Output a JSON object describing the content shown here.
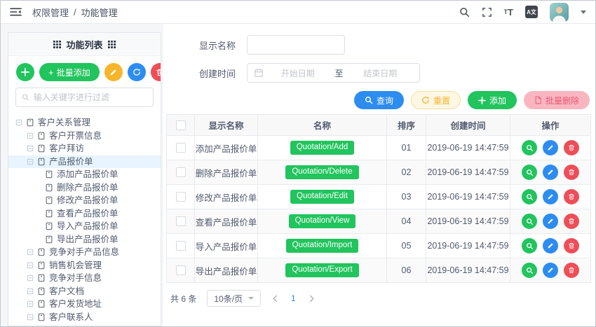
{
  "header": {
    "breadcrumb": {
      "section": "权限管理",
      "separator": "/",
      "current": "功能管理"
    }
  },
  "sidebar": {
    "title": "功能列表",
    "batch_add_label": "批量添加",
    "filter_placeholder": "输入关键字进行过滤",
    "tree": [
      {
        "label": "客户关系管理",
        "level": 1,
        "type": "branch"
      },
      {
        "label": "客户开票信息",
        "level": 2,
        "type": "branch"
      },
      {
        "label": "客户拜访",
        "level": 2,
        "type": "branch"
      },
      {
        "label": "产品报价单",
        "level": 2,
        "type": "branch",
        "selected": true
      },
      {
        "label": "添加产品报价单",
        "level": 3,
        "type": "leaf"
      },
      {
        "label": "删除产品报价单",
        "level": 3,
        "type": "leaf"
      },
      {
        "label": "修改产品报价单",
        "level": 3,
        "type": "leaf"
      },
      {
        "label": "查看产品报价单",
        "level": 3,
        "type": "leaf"
      },
      {
        "label": "导入产品报价单",
        "level": 3,
        "type": "leaf"
      },
      {
        "label": "导出产品报价单",
        "level": 3,
        "type": "leaf"
      },
      {
        "label": "竞争对手产品信息",
        "level": 2,
        "type": "branch"
      },
      {
        "label": "销售机会管理",
        "level": 2,
        "type": "branch"
      },
      {
        "label": "竞争对手信息",
        "level": 2,
        "type": "branch"
      },
      {
        "label": "客户文档",
        "level": 2,
        "type": "branch"
      },
      {
        "label": "客户发货地址",
        "level": 2,
        "type": "branch"
      },
      {
        "label": "客户联系人",
        "level": 2,
        "type": "branch"
      }
    ]
  },
  "filters": {
    "display_name_label": "显示名称",
    "display_name_value": "",
    "create_time_label": "创建时间",
    "start_placeholder": "开始日期",
    "range_separator": "至",
    "end_placeholder": "结束日期"
  },
  "actions": {
    "query": "查询",
    "reset": "重置",
    "add": "添加",
    "batch_delete": "批量删除"
  },
  "table": {
    "columns": [
      "显示名称",
      "名称",
      "排序",
      "创建时间",
      "操作"
    ],
    "rows": [
      {
        "display_name": "添加产品报价单",
        "name": "Quotation/Add",
        "sort": "01",
        "created": "2019-06-19 14:47:59"
      },
      {
        "display_name": "删除产品报价单",
        "name": "Quotation/Delete",
        "sort": "02",
        "created": "2019-06-19 14:47:59"
      },
      {
        "display_name": "修改产品报价单",
        "name": "Quotation/Edit",
        "sort": "03",
        "created": "2019-06-19 14:47:59"
      },
      {
        "display_name": "查看产品报价单",
        "name": "Quotation/View",
        "sort": "04",
        "created": "2019-06-19 14:47:59"
      },
      {
        "display_name": "导入产品报价单",
        "name": "Quotation/Import",
        "sort": "05",
        "created": "2019-06-19 14:47:59"
      },
      {
        "display_name": "导出产品报价单",
        "name": "Quotation/Export",
        "sort": "06",
        "created": "2019-06-19 14:47:59"
      }
    ]
  },
  "pagination": {
    "total": "共 6 条",
    "page_size": "10条/页",
    "current_page": "1"
  },
  "colors": {
    "primary_blue": "#2d8cf0",
    "green": "#21c45d",
    "yellow": "#f7b52c",
    "red": "#ee4e58",
    "pink_bg": "#f9b6c1",
    "pink_text": "#ee5873",
    "reset_bg": "#fdf7e3",
    "reset_border": "#f6dfa2",
    "selected_bg": "#e8f4ff",
    "header_text": "#515a6e"
  }
}
